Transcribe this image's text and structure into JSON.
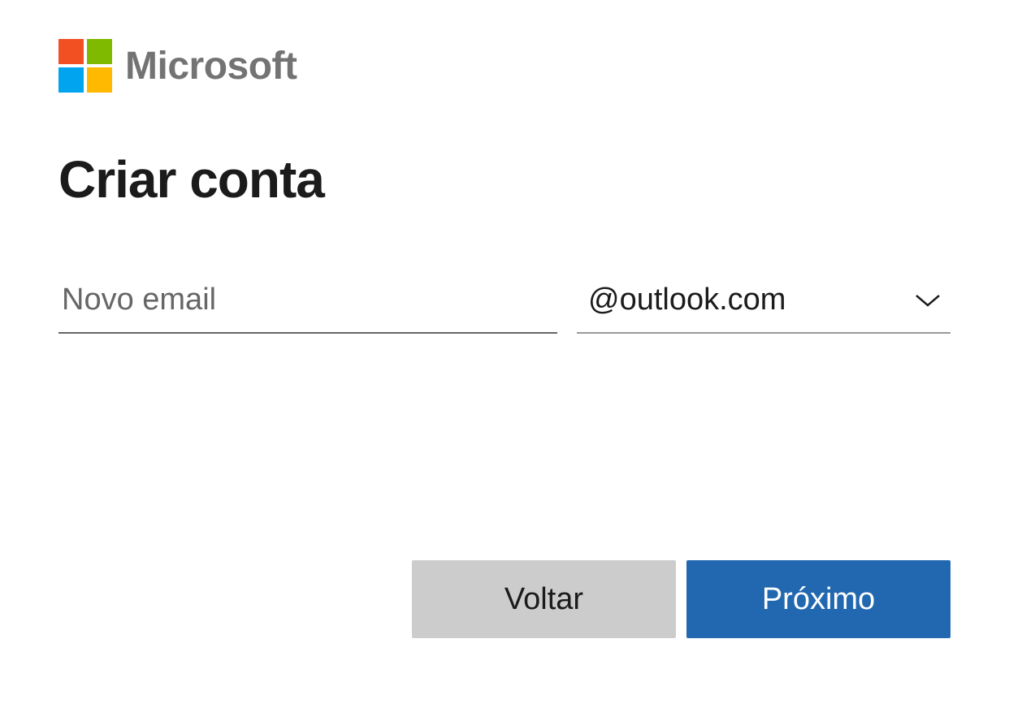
{
  "brand": {
    "name": "Microsoft"
  },
  "page": {
    "heading": "Criar conta"
  },
  "form": {
    "email_placeholder": "Novo email",
    "email_value": "",
    "domain_selected": "@outlook.com"
  },
  "buttons": {
    "back": "Voltar",
    "next": "Próximo"
  }
}
